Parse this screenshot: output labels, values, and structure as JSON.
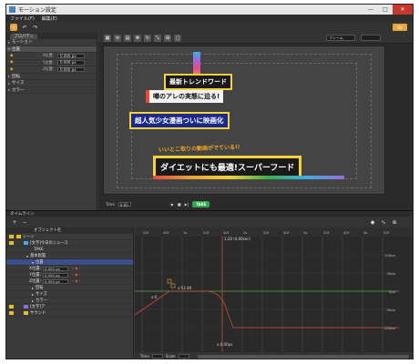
{
  "window": {
    "title": "モーション設定",
    "controls": [
      "—",
      "□",
      "✕"
    ]
  },
  "menu": [
    "ファイル(F)",
    "編集(E)"
  ],
  "toolbar": {
    "ok_label": "OK"
  },
  "left_panel": {
    "tab_label": "プロパティ",
    "rows": [
      {
        "label": "モーション",
        "indent": 1
      },
      {
        "label": "位置",
        "indent": 1
      },
      {
        "label": "X位置:",
        "value": "0.000 px"
      },
      {
        "label": "Y位置:",
        "value": "0.000 px"
      },
      {
        "label": "Z位置:",
        "value": "0.000 px"
      },
      {
        "label": "回転",
        "indent": 1
      },
      {
        "label": "サイズ",
        "indent": 1
      },
      {
        "label": "カラー",
        "indent": 1
      }
    ]
  },
  "preview": {
    "select_label": "フレーム",
    "canvas_texts": [
      {
        "text": "最新トレンドワード",
        "color": "#ffffff",
        "bg": "#1a1a1a"
      },
      {
        "text": "噂のアレの実態に迫る!",
        "color": "#111111",
        "bg": "#f2f2f2"
      },
      {
        "text": "超人気少女漫画ついに映画化",
        "color": "#ffffff",
        "bg": "#1b2a8a"
      },
      {
        "text": "いいとこ取りの動画がでている!!",
        "color": "#f2a522",
        "bg": ""
      },
      {
        "text": "ダイエットにも最適!スーパーフード",
        "color": "#ffffff",
        "bg": "#1a1a1a"
      }
    ],
    "time_label": "Time",
    "time_value": "0:00",
    "take_label": "TAKE"
  },
  "timeline": {
    "header": "タイムライン",
    "col_header": "オブジェクト名",
    "rows": [
      {
        "label": "シーン",
        "level": 0,
        "color": "#e5c02d"
      },
      {
        "label": "[文字]今日のニュース",
        "level": 1,
        "color": "#3ab0e6"
      },
      {
        "label": "TAKE",
        "level": 2,
        "color": ""
      },
      {
        "label": "基本配置",
        "level": 2,
        "color": ""
      },
      {
        "label": "位置",
        "level": 3,
        "color": "",
        "selected": true
      },
      {
        "label": "X位置:",
        "value": "0.000 px",
        "level": 4
      },
      {
        "label": "Y位置:",
        "value": "0.000 px",
        "level": 4
      },
      {
        "label": "Z位置:",
        "value": "0.000 px",
        "level": 4
      },
      {
        "label": "回転",
        "level": 3
      },
      {
        "label": "サイズ",
        "level": 3
      },
      {
        "label": "カラー",
        "level": 3
      },
      {
        "label": "[文字]ア",
        "level": 1,
        "color": "#9a6ad6"
      },
      {
        "label": "サウンド",
        "level": 1,
        "color": "#e5c02d"
      }
    ],
    "ruler_labels": [
      "20f",
      "40f",
      "1s",
      "20f",
      "40f",
      "2s",
      "20f",
      "40f",
      "3s",
      "20f",
      "40f",
      "4s",
      "20f"
    ],
    "playhead_label": "1:20 (4.00sec)",
    "y_axis_labels": [
      "100px",
      "50px",
      "0px",
      "-50px",
      "-100px"
    ],
    "key_labels": [
      "x:52.89",
      "x:0",
      "x:0.00px"
    ],
    "bottom_labels": [
      "Time",
      "Scale"
    ]
  }
}
